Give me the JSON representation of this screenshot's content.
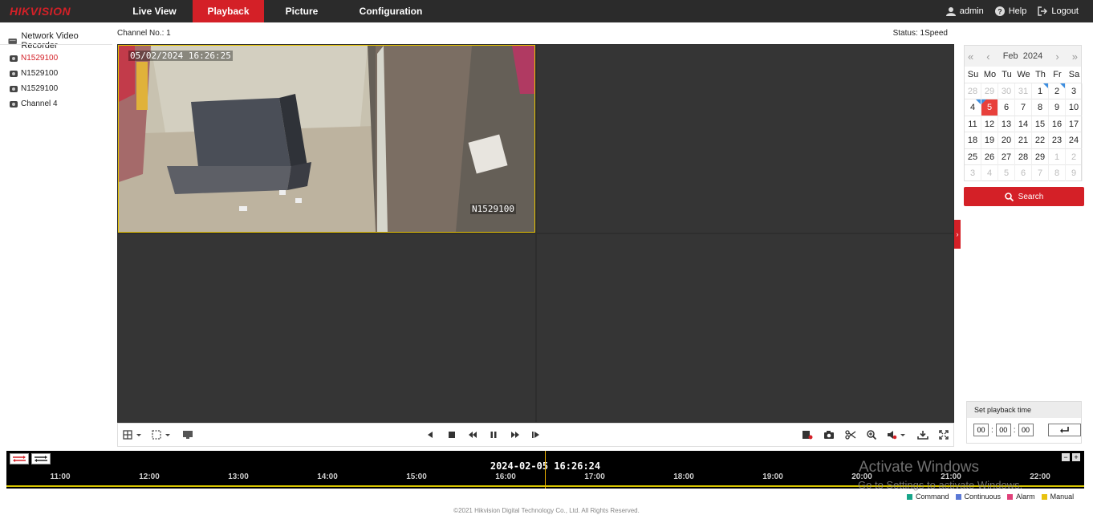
{
  "header": {
    "logo": "HIKVISION",
    "nav": [
      "Live View",
      "Playback",
      "Picture",
      "Configuration"
    ],
    "active_nav": "Playback",
    "user": "admin",
    "help": "Help",
    "logout": "Logout"
  },
  "sidebar": {
    "title": "Network Video Recorder",
    "cameras": [
      {
        "label": "N1529100",
        "active": true
      },
      {
        "label": "N1529100",
        "active": false
      },
      {
        "label": "N1529100",
        "active": false
      },
      {
        "label": "Channel 4",
        "active": false
      }
    ]
  },
  "main": {
    "channel_no": "Channel No.: 1",
    "status": "Status: 1Speed",
    "osd_time": "05/02/2024 16:26:25",
    "osd_name": "N1529100"
  },
  "calendar": {
    "month": "Feb",
    "year": "2024",
    "weekdays": [
      "Su",
      "Mo",
      "Tu",
      "We",
      "Th",
      "Fr",
      "Sa"
    ],
    "weeks": [
      [
        "28",
        "29",
        "30",
        "31",
        "1",
        "2",
        "3"
      ],
      [
        "4",
        "5",
        "6",
        "7",
        "8",
        "9",
        "10"
      ],
      [
        "11",
        "12",
        "13",
        "14",
        "15",
        "16",
        "17"
      ],
      [
        "18",
        "19",
        "20",
        "21",
        "22",
        "23",
        "24"
      ],
      [
        "25",
        "26",
        "27",
        "28",
        "29",
        "1",
        "2"
      ],
      [
        "3",
        "4",
        "5",
        "6",
        "7",
        "8",
        "9"
      ]
    ],
    "selected_day": "5",
    "days_with_records": [
      "1",
      "2",
      "4",
      "5"
    ],
    "search_label": "Search"
  },
  "playback_time": {
    "title": "Set playback time",
    "hh": "00",
    "mm": "00",
    "ss": "00"
  },
  "timeline": {
    "current": "2024-02-05 16:26:24",
    "ticks": [
      "11:00",
      "12:00",
      "13:00",
      "14:00",
      "15:00",
      "16:00",
      "17:00",
      "18:00",
      "19:00",
      "20:00",
      "21:00",
      "22:00"
    ]
  },
  "legend": [
    {
      "label": "Command",
      "color": "#17a589"
    },
    {
      "label": "Continuous",
      "color": "#5a78d6"
    },
    {
      "label": "Alarm",
      "color": "#e0417a"
    },
    {
      "label": "Manual",
      "color": "#e8c20f"
    }
  ],
  "watermark": {
    "line1": "Activate Windows",
    "line2": "Go to Settings to activate Windows."
  },
  "footer": "©2021 Hikvision Digital Technology Co., Ltd. All Rights Reserved.",
  "colors": {
    "brand": "#d42027",
    "accent": "#3d8ee0"
  }
}
